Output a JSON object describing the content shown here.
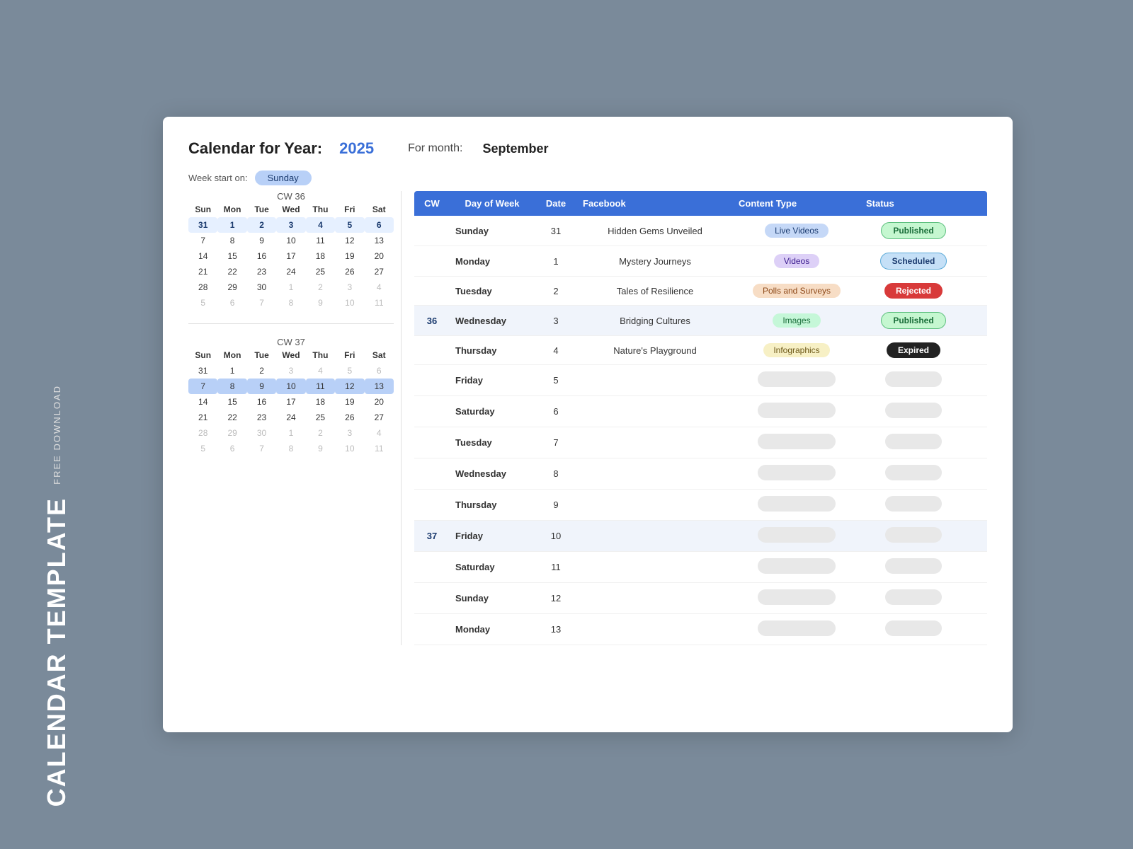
{
  "sidebar": {
    "free_download": "FREE DOWNLOAD",
    "calendar_template": "CALENDAR TEMPLATE"
  },
  "header": {
    "title": "Calendar for Year:",
    "year": "2025",
    "for_month_label": "For month:",
    "month": "September"
  },
  "week_start": {
    "label": "Week start on:",
    "value": "Sunday"
  },
  "cw36": {
    "label": "CW 36",
    "days_header": [
      "Sun",
      "Mon",
      "Tue",
      "Wed",
      "Thu",
      "Fri",
      "Sat"
    ],
    "weeks": [
      [
        "31",
        "1",
        "2",
        "3",
        "4",
        "5",
        "6"
      ],
      [
        "7",
        "8",
        "9",
        "10",
        "11",
        "12",
        "13"
      ],
      [
        "14",
        "15",
        "16",
        "17",
        "18",
        "19",
        "20"
      ],
      [
        "21",
        "22",
        "23",
        "24",
        "25",
        "26",
        "27"
      ],
      [
        "28",
        "29",
        "30",
        "1",
        "2",
        "3",
        "4"
      ],
      [
        "5",
        "6",
        "7",
        "8",
        "9",
        "10",
        "11"
      ]
    ],
    "other_month_indices": {
      "0": [
        0
      ],
      "4": [
        3,
        4,
        5,
        6
      ],
      "5": [
        0,
        1,
        2,
        3,
        4,
        5,
        6
      ]
    }
  },
  "cw37": {
    "label": "CW 37",
    "days_header": [
      "Sun",
      "Mon",
      "Tue",
      "Wed",
      "Thu",
      "Fri",
      "Sat"
    ],
    "weeks": [
      [
        "31",
        "1",
        "2",
        "3",
        "4",
        "5",
        "6"
      ],
      [
        "7",
        "8",
        "9",
        "10",
        "11",
        "12",
        "13"
      ],
      [
        "14",
        "15",
        "16",
        "17",
        "18",
        "19",
        "20"
      ],
      [
        "21",
        "22",
        "23",
        "24",
        "25",
        "26",
        "27"
      ],
      [
        "28",
        "29",
        "30",
        "1",
        "2",
        "3",
        "4"
      ],
      [
        "5",
        "6",
        "7",
        "8",
        "9",
        "10",
        "11"
      ]
    ],
    "highlight_week": 1
  },
  "table": {
    "columns": [
      "CW",
      "Day of Week",
      "Date",
      "Facebook",
      "Content Type",
      "Status"
    ],
    "rows_cw36": [
      {
        "cw": "",
        "day": "Sunday",
        "date": "31",
        "facebook": "Hidden Gems Unveiled",
        "content_type": "Live Videos",
        "content_type_class": "badge-blue",
        "status": "Published",
        "status_class": "status-published"
      },
      {
        "cw": "",
        "day": "Monday",
        "date": "1",
        "facebook": "Mystery Journeys",
        "content_type": "Videos",
        "content_type_class": "badge-purple",
        "status": "Scheduled",
        "status_class": "status-scheduled"
      },
      {
        "cw": "",
        "day": "Tuesday",
        "date": "2",
        "facebook": "Tales of Resilience",
        "content_type": "Polls and Surveys",
        "content_type_class": "badge-orange",
        "status": "Rejected",
        "status_class": "status-rejected"
      },
      {
        "cw": "36",
        "day": "Wednesday",
        "date": "3",
        "facebook": "Bridging Cultures",
        "content_type": "Images",
        "content_type_class": "badge-green",
        "status": "Published",
        "status_class": "status-published"
      },
      {
        "cw": "",
        "day": "Thursday",
        "date": "4",
        "facebook": "Nature's Playground",
        "content_type": "Infographics",
        "content_type_class": "badge-yellow",
        "status": "Expired",
        "status_class": "status-expired"
      },
      {
        "cw": "",
        "day": "Friday",
        "date": "5",
        "facebook": "",
        "content_type": "",
        "status": ""
      },
      {
        "cw": "",
        "day": "Saturday",
        "date": "6",
        "facebook": "",
        "content_type": "",
        "status": ""
      }
    ],
    "rows_cw37": [
      {
        "cw": "",
        "day": "Tuesday",
        "date": "7",
        "facebook": "",
        "content_type": "",
        "status": ""
      },
      {
        "cw": "",
        "day": "Wednesday",
        "date": "8",
        "facebook": "",
        "content_type": "",
        "status": ""
      },
      {
        "cw": "",
        "day": "Thursday",
        "date": "9",
        "facebook": "",
        "content_type": "",
        "status": ""
      },
      {
        "cw": "37",
        "day": "Friday",
        "date": "10",
        "facebook": "",
        "content_type": "",
        "status": ""
      },
      {
        "cw": "",
        "day": "Saturday",
        "date": "11",
        "facebook": "",
        "content_type": "",
        "status": ""
      },
      {
        "cw": "",
        "day": "Sunday",
        "date": "12",
        "facebook": "",
        "content_type": "",
        "status": ""
      },
      {
        "cw": "",
        "day": "Monday",
        "date": "13",
        "facebook": "",
        "content_type": "",
        "status": ""
      }
    ]
  }
}
